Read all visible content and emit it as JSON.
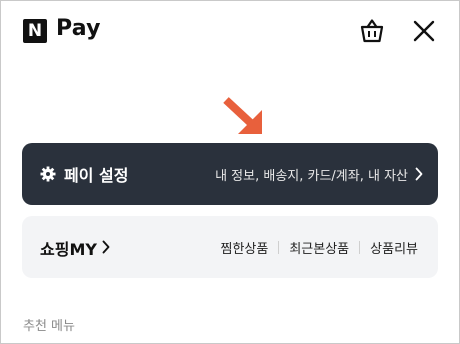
{
  "header": {
    "logo_letter": "N",
    "brand": "Pay",
    "cart_icon": "shopping-bag-icon",
    "close_icon": "close-icon"
  },
  "pointer": {
    "icon": "arrow-down-right-icon",
    "color": "#e8603c"
  },
  "settings_card": {
    "title": "페이 설정",
    "description": "내 정보, 배송지, 카드/계좌, 내 자산",
    "icon": "gear-icon",
    "background": "#2a313c"
  },
  "shopping_card": {
    "title": "쇼핑MY",
    "links": [
      "찜한상품",
      "최근본상품",
      "상품리뷰"
    ],
    "background": "#f3f4f6"
  },
  "section": {
    "recommended_menu": "추천 메뉴"
  }
}
